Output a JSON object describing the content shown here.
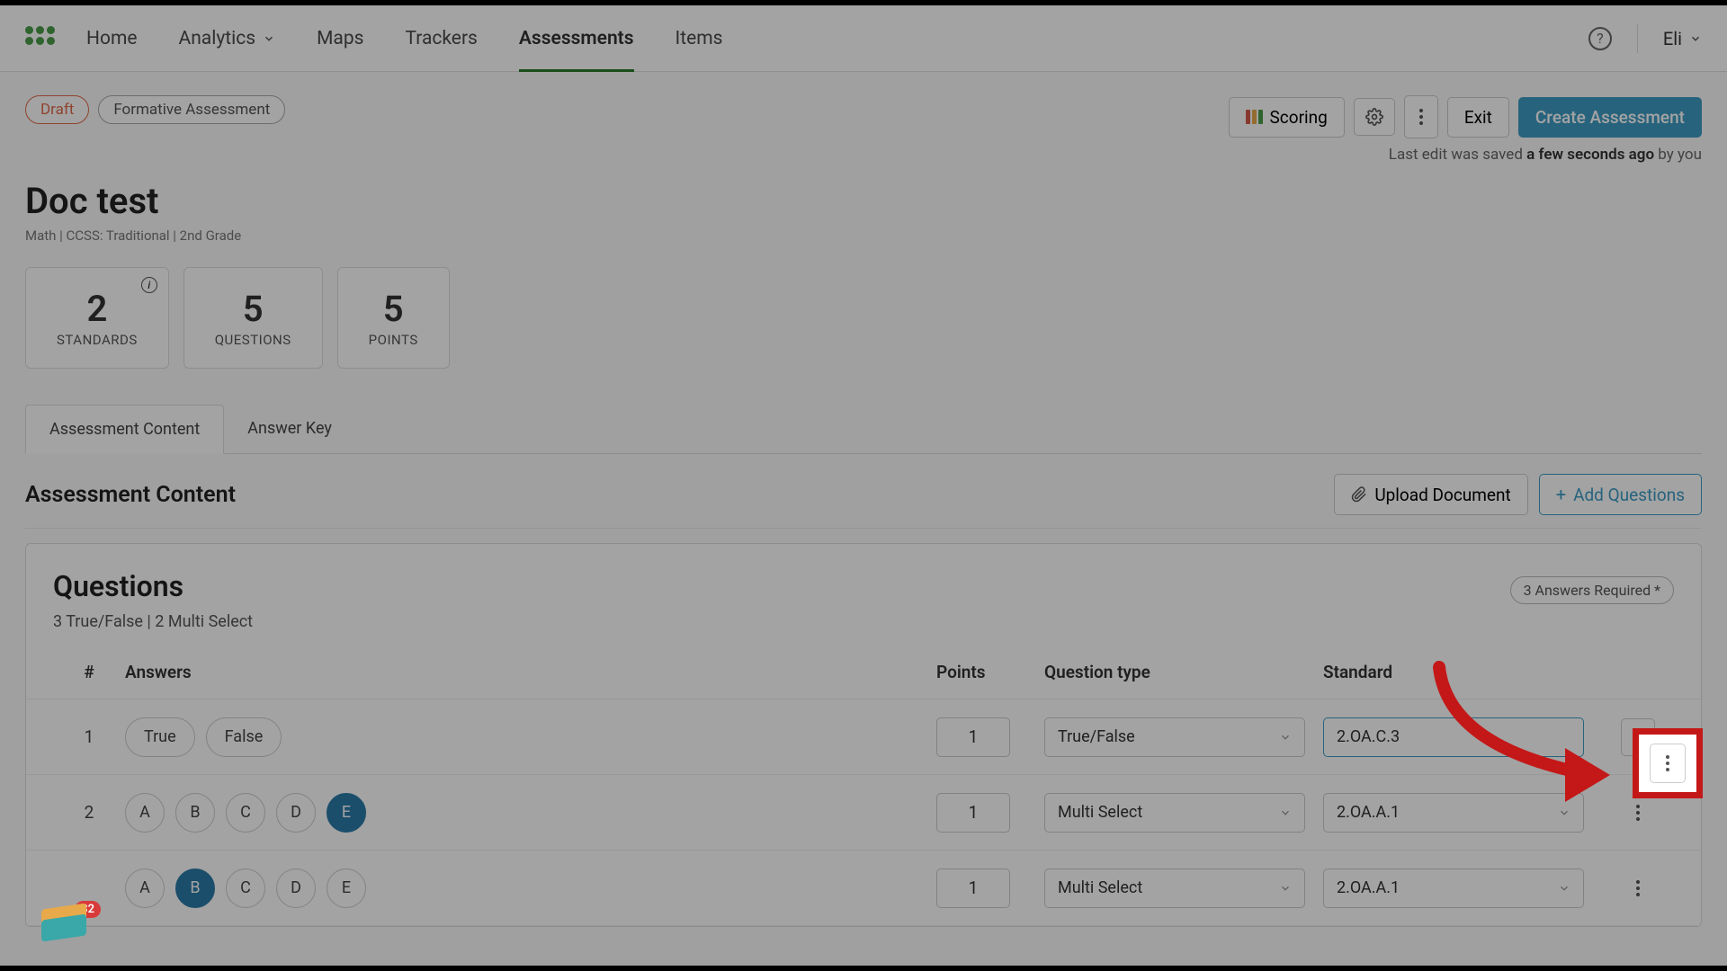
{
  "nav": {
    "items": [
      "Home",
      "Analytics",
      "Maps",
      "Trackers",
      "Assessments",
      "Items"
    ],
    "activeIndex": 4,
    "user": "Eli"
  },
  "header": {
    "badges": {
      "draft": "Draft",
      "type": "Formative Assessment"
    },
    "actions": {
      "scoring": "Scoring",
      "exit": "Exit",
      "create": "Create Assessment"
    },
    "lastSavedPrefix": "Last edit was saved ",
    "lastSavedBold": "a few seconds ago",
    "lastSavedSuffix": " by you"
  },
  "title": "Doc test",
  "meta": "Math  |  CCSS: Traditional  |  2nd Grade",
  "stats": [
    {
      "val": "2",
      "lbl": "STANDARDS",
      "info": true
    },
    {
      "val": "5",
      "lbl": "QUESTIONS"
    },
    {
      "val": "5",
      "lbl": "POINTS"
    }
  ],
  "tabs": {
    "content": "Assessment Content",
    "answerKey": "Answer Key"
  },
  "section": {
    "title": "Assessment Content",
    "upload": "Upload Document",
    "add": "Add Questions"
  },
  "questions": {
    "title": "Questions",
    "subtitle": "3 True/False | 2 Multi Select",
    "required": "3 Answers Required *",
    "columns": {
      "num": "#",
      "answers": "Answers",
      "points": "Points",
      "qtype": "Question type",
      "standard": "Standard"
    },
    "rows": [
      {
        "num": "1",
        "answers": [
          {
            "t": "True"
          },
          {
            "t": "False"
          }
        ],
        "points": "1",
        "qtype": "True/False",
        "standard": "2.OA.C.3"
      },
      {
        "num": "2",
        "answers": [
          {
            "t": "A"
          },
          {
            "t": "B"
          },
          {
            "t": "C"
          },
          {
            "t": "D"
          },
          {
            "t": "E",
            "sel": true
          }
        ],
        "points": "1",
        "qtype": "Multi Select",
        "standard": "2.OA.A.1"
      },
      {
        "num": "",
        "answers": [
          {
            "t": "A"
          },
          {
            "t": "B",
            "sel": true
          },
          {
            "t": "C"
          },
          {
            "t": "D"
          },
          {
            "t": "E"
          }
        ],
        "points": "1",
        "qtype": "Multi Select",
        "standard": "2.OA.A.1"
      }
    ]
  },
  "widget": {
    "count": "32"
  }
}
